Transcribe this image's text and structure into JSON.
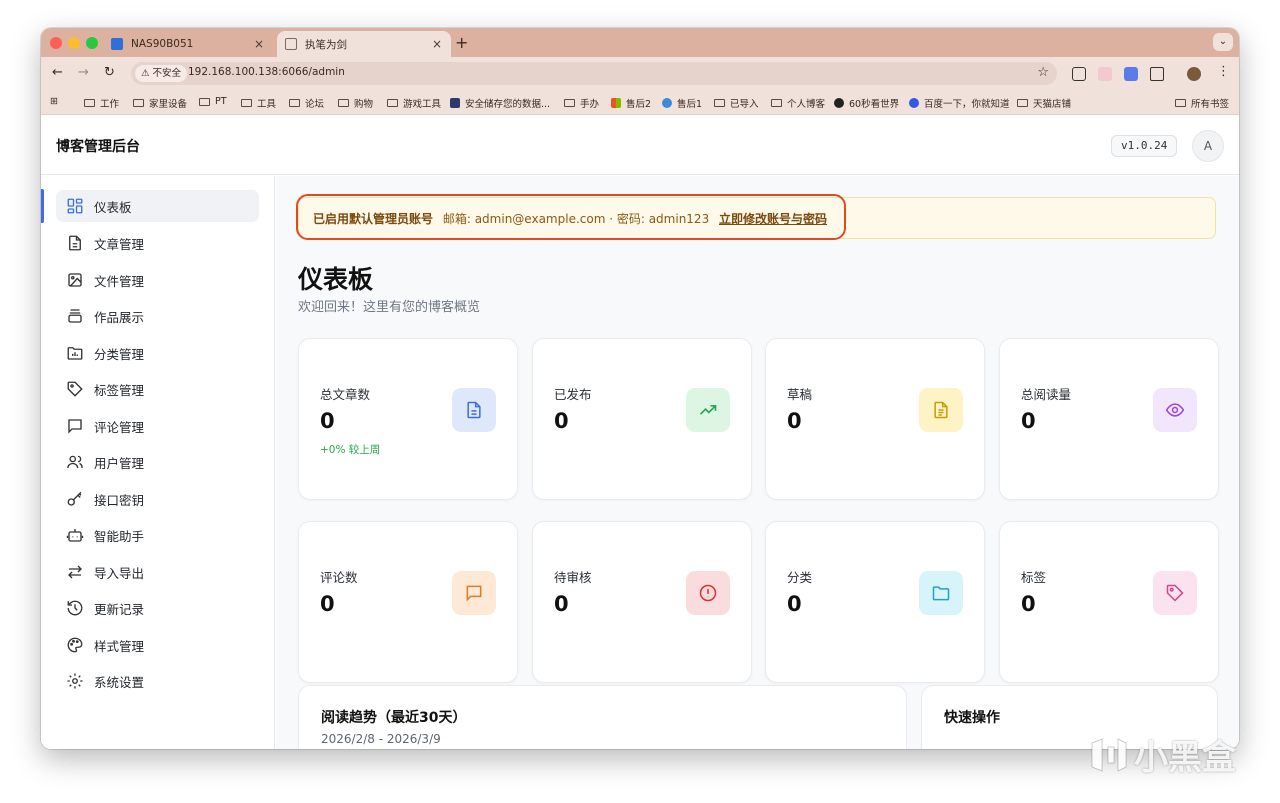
{
  "browser": {
    "tabs": [
      {
        "title": "NAS90B051",
        "close": "×",
        "active": false
      },
      {
        "title": "执笔为剑",
        "close": "×",
        "active": true
      }
    ],
    "new_tab": "+",
    "tab_menu": "⌄",
    "nav": {
      "back": "←",
      "forward": "→",
      "reload": "↻"
    },
    "security_label": "不安全",
    "url": "192.168.100.138:6066/admin",
    "bookmark_star": "☆",
    "bookmarks": [
      "工作",
      "家里设备",
      "PT",
      "工具",
      "论坛",
      "购物",
      "游戏工具",
      "安全储存您的数据...",
      "手办",
      "售后2",
      "售后1",
      "已导入",
      "个人博客",
      "60秒看世界",
      "百度一下，你就知道",
      "天猫店铺"
    ],
    "all_bookmarks": "所有书签"
  },
  "app": {
    "title": "博客管理后台",
    "version": "v1.0.24",
    "avatar": "A"
  },
  "sidebar": {
    "items": [
      {
        "label": "仪表板",
        "icon": "dashboard-icon",
        "active": true
      },
      {
        "label": "文章管理",
        "icon": "document-icon"
      },
      {
        "label": "文件管理",
        "icon": "image-file-icon"
      },
      {
        "label": "作品展示",
        "icon": "layers-icon"
      },
      {
        "label": "分类管理",
        "icon": "folder-chart-icon"
      },
      {
        "label": "标签管理",
        "icon": "tag-icon"
      },
      {
        "label": "评论管理",
        "icon": "comment-icon"
      },
      {
        "label": "用户管理",
        "icon": "users-icon"
      },
      {
        "label": "接口密钥",
        "icon": "key-icon"
      },
      {
        "label": "智能助手",
        "icon": "robot-icon"
      },
      {
        "label": "导入导出",
        "icon": "arrows-swap-icon"
      },
      {
        "label": "更新记录",
        "icon": "history-icon"
      },
      {
        "label": "样式管理",
        "icon": "palette-icon"
      },
      {
        "label": "系统设置",
        "icon": "gear-icon"
      }
    ]
  },
  "banner": {
    "strong": "已启用默认管理员账号",
    "detail": "邮箱: admin@example.com · 密码: admin123",
    "link": "立即修改账号与密码"
  },
  "dashboard": {
    "title": "仪表板",
    "subtitle": "欢迎回来！这里有您的博客概览",
    "stats": [
      {
        "label": "总文章数",
        "value": "0",
        "trend": "+0% 较上周",
        "icon": "document-icon",
        "icon_bg": "#dfe8fb",
        "icon_color": "#3b6fe0"
      },
      {
        "label": "已发布",
        "value": "0",
        "icon": "trending-up-icon",
        "icon_bg": "#dcf6e3",
        "icon_color": "#2aa652"
      },
      {
        "label": "草稿",
        "value": "0",
        "icon": "draft-icon",
        "icon_bg": "#fdf3c4",
        "icon_color": "#c99a0a"
      },
      {
        "label": "总阅读量",
        "value": "0",
        "icon": "eye-icon",
        "icon_bg": "#f1e6fb",
        "icon_color": "#9b45d6"
      },
      {
        "label": "评论数",
        "value": "0",
        "icon": "comment-icon",
        "icon_bg": "#fde9d6",
        "icon_color": "#e47a1c"
      },
      {
        "label": "待审核",
        "value": "0",
        "icon": "alert-circle-icon",
        "icon_bg": "#fbdcdc",
        "icon_color": "#dc2f2f"
      },
      {
        "label": "分类",
        "value": "0",
        "icon": "folder-icon",
        "icon_bg": "#d7f4fa",
        "icon_color": "#1fa3c4"
      },
      {
        "label": "标签",
        "value": "0",
        "icon": "tag-icon",
        "icon_bg": "#fbe2ef",
        "icon_color": "#d6438c"
      }
    ],
    "trend_panel": {
      "title": "阅读趋势（最近30天）",
      "range": "2026/2/8 - 2026/3/9"
    },
    "quick_panel": {
      "title": "快速操作"
    }
  },
  "watermark": "小黑盒",
  "colors": {
    "accent": "#3b6fe0",
    "highlight_ring": "#de4a24",
    "banner_bg": "#fef9e8"
  }
}
